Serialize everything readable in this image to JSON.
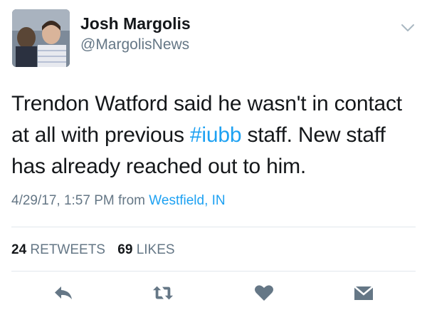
{
  "tweet": {
    "author": {
      "display_name": "Josh Margolis",
      "handle": "@MargolisNews"
    },
    "text_lines": [
      [
        "Trendon Watford said he wasn't in contact"
      ],
      [
        "at all with previous ",
        "#iubb",
        " staff. New staff"
      ],
      [
        "has already reached out to him."
      ]
    ],
    "line1": "Trendon Watford said he wasn't in contact",
    "line2_pre": "at all with previous ",
    "hashtag": "#iubb",
    "line2_post": " staff. New staff",
    "line3": "has already reached out to him.",
    "timestamp": "4/29/17, 1:57 PM",
    "from_label": "from",
    "location": "Westfield, IN",
    "retweets_count": "24",
    "retweets_label": "RETWEETS",
    "likes_count": "69",
    "likes_label": "LIKES"
  },
  "colors": {
    "text": "#14171a",
    "secondary": "#657786",
    "link": "#1da1f2",
    "icon": "#657786",
    "divider": "#e1e8ed"
  },
  "icons": {
    "menu": "chevron-down-icon",
    "reply": "reply-icon",
    "retweet": "retweet-icon",
    "like": "heart-icon",
    "dm": "envelope-icon"
  }
}
